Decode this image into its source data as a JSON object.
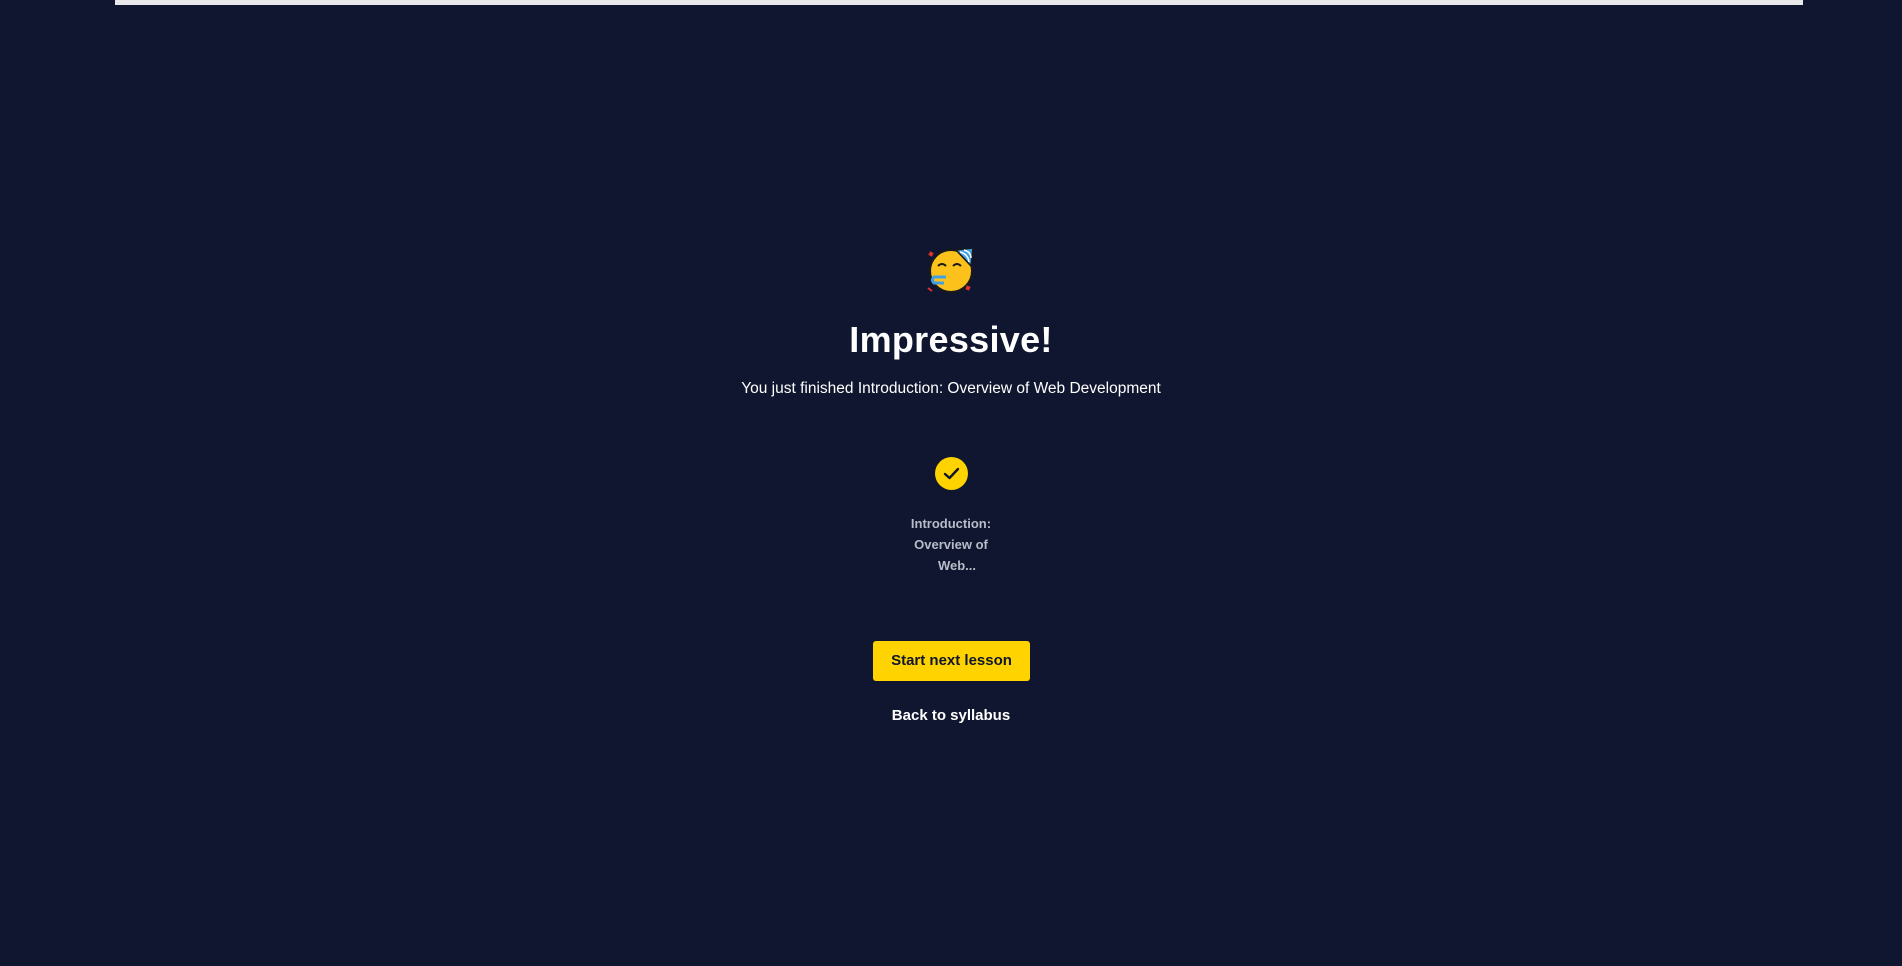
{
  "celebration": {
    "icon": "partying-face-icon",
    "headline": "Impressive!",
    "subtitle": "You just finished Introduction: Overview of Web Development"
  },
  "lesson": {
    "status_icon": "checkmark-icon",
    "label_lines": [
      "Introduction:",
      "Overview of",
      "Web..."
    ]
  },
  "actions": {
    "next_label": "Start next lesson",
    "back_label": "Back to syllabus"
  },
  "colors": {
    "background": "#10162f",
    "accent": "#ffd300",
    "text": "#ffffff",
    "muted_text": "#b8bcc8"
  }
}
